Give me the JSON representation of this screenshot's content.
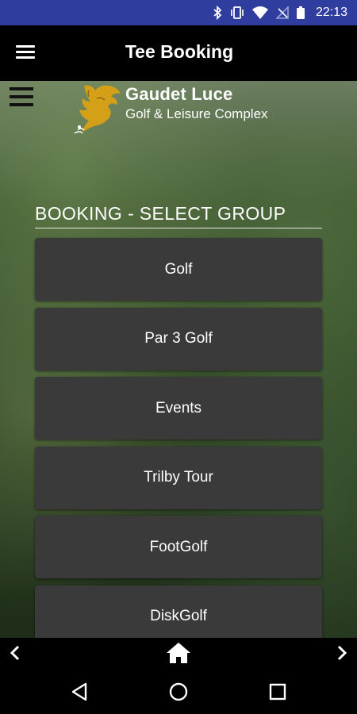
{
  "status_bar": {
    "time": "22:13",
    "icons": [
      "bluetooth-icon",
      "vibrate-icon",
      "wifi-icon",
      "no-signal-icon",
      "battery-icon"
    ]
  },
  "app_bar": {
    "title": "Tee Booking",
    "menu_icon": "hamburger-menu-icon"
  },
  "logo": {
    "name": "Gaudet Luce",
    "subtitle": "Golf & Leisure Complex"
  },
  "booking": {
    "section_title": "BOOKING - SELECT GROUP",
    "groups": [
      {
        "label": "Golf"
      },
      {
        "label": "Par 3 Golf"
      },
      {
        "label": "Events"
      },
      {
        "label": "Trilby Tour"
      },
      {
        "label": "FootGolf"
      },
      {
        "label": "DiskGolf"
      }
    ]
  },
  "toolbar": {
    "icons": [
      "chevron-left-icon",
      "home-icon",
      "chevron-right-icon"
    ]
  },
  "nav_bar": {
    "icons": [
      "nav-back-icon",
      "nav-home-icon",
      "nav-recents-icon"
    ]
  },
  "colors": {
    "status_bar": "#2f3e9e",
    "button_bg": "#3a3a3a",
    "logo_gold": "#d4a017"
  }
}
